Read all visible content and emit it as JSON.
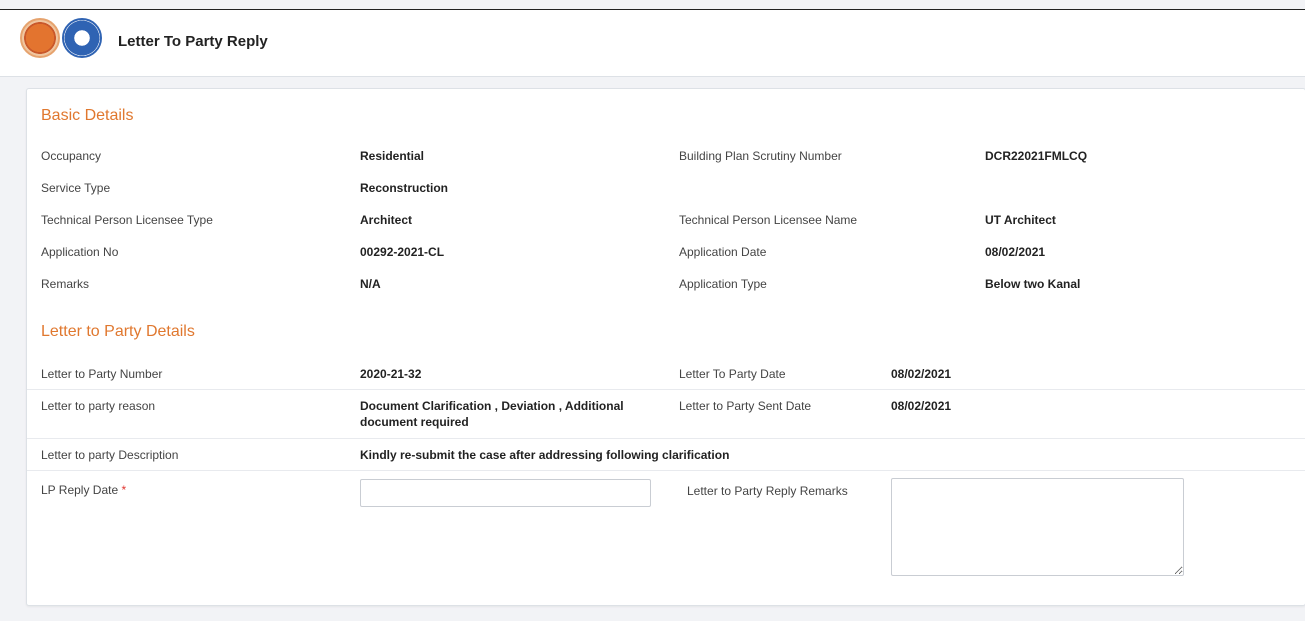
{
  "header": {
    "title": "Letter To Party Reply"
  },
  "basic": {
    "title": "Basic Details",
    "occupancy_label": "Occupancy",
    "occupancy_value": "Residential",
    "bps_label": "Building Plan Scrutiny Number",
    "bps_value": "DCR22021FMLCQ",
    "service_label": "Service Type",
    "service_value": "Reconstruction",
    "tp_type_label": "Technical Person Licensee Type",
    "tp_type_value": "Architect",
    "tp_name_label": "Technical Person Licensee Name",
    "tp_name_value": "UT Architect",
    "app_no_label": "Application No",
    "app_no_value": "00292-2021-CL",
    "app_date_label": "Application Date",
    "app_date_value": "08/02/2021",
    "remarks_label": "Remarks",
    "remarks_value": "N/A",
    "app_type_label": "Application Type",
    "app_type_value": "Below two Kanal"
  },
  "ltp": {
    "title": "Letter to Party Details",
    "number_label": "Letter to Party Number",
    "number_value": "2020-21-32",
    "date_label": "Letter To Party Date",
    "date_value": "08/02/2021",
    "reason_label": "Letter to party reason",
    "reason_value_line1": "Document Clarification , Deviation , Additional",
    "reason_value_line2": "document required",
    "sent_label": "Letter to Party Sent Date",
    "sent_value": "08/02/2021",
    "desc_label": "Letter to party Description",
    "desc_value": "Kindly re-submit the case after addressing following clarification"
  },
  "form": {
    "reply_date_label": "LP Reply Date",
    "required_marker": "*",
    "reply_date_value": "",
    "reply_remarks_label": "Letter to Party Reply Remarks",
    "reply_remarks_value": ""
  }
}
